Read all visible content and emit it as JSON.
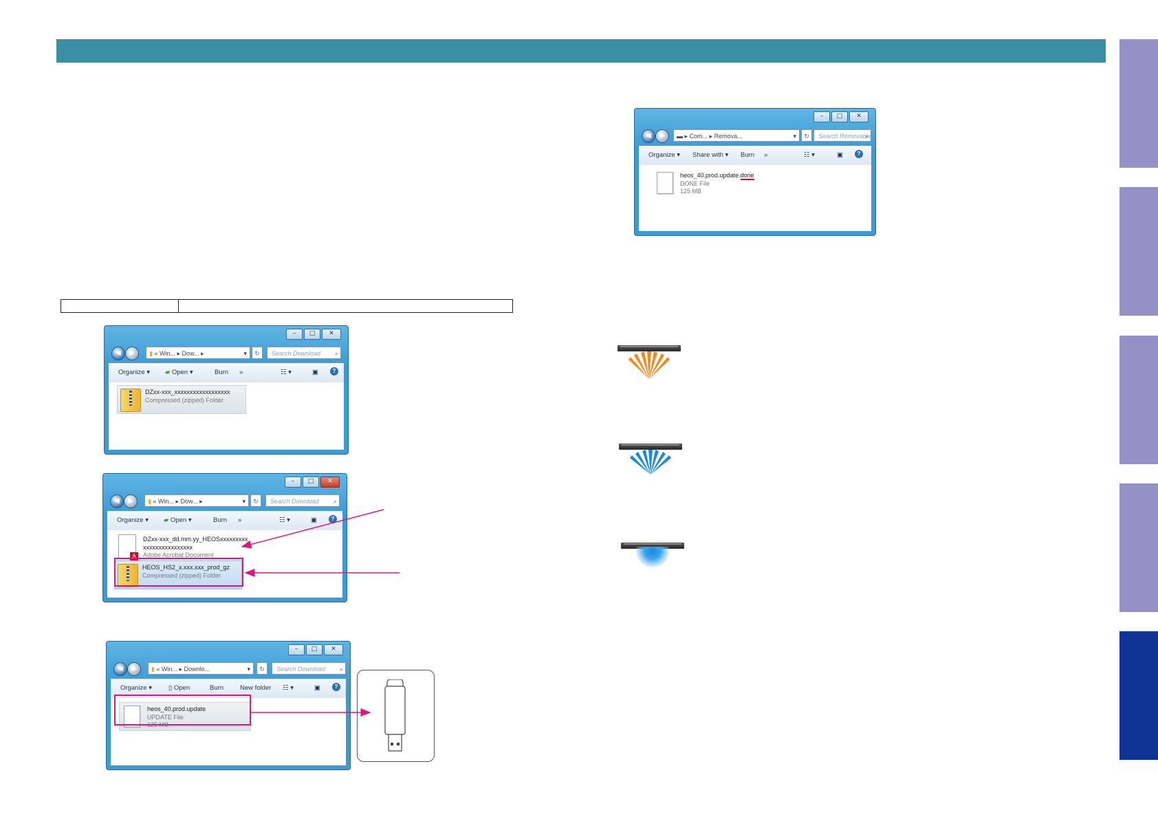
{
  "explorer_top_right": {
    "address_parts": [
      "Com...",
      "Remova..."
    ],
    "search_placeholder": "Search Removable ...",
    "toolbar": {
      "organize": "Organize",
      "share_with": "Share with",
      "burn": "Burn",
      "more": "»"
    },
    "file": {
      "name_prefix": "heos_40.prod.update.",
      "name_suffix": "done",
      "type": "DONE File",
      "size": "125 MB"
    }
  },
  "explorer_1": {
    "address_parts": [
      "«",
      "Win...",
      "Dow..."
    ],
    "search_placeholder": "Search Download",
    "toolbar": {
      "organize": "Organize",
      "open": "Open",
      "burn": "Burn",
      "more": "»"
    },
    "file": {
      "name": "DZxx-xxx_xxxxxxxxxxxxxxxxxx",
      "type": "Compressed (zipped) Folder"
    }
  },
  "explorer_2": {
    "address_parts": [
      "«",
      "Win...",
      "Dow..."
    ],
    "search_placeholder": "Search Download",
    "toolbar": {
      "organize": "Organize",
      "open": "Open",
      "burn": "Burn",
      "more": "»"
    },
    "file_pdf": {
      "name_line1": "DZxx-xxx_dd.mm.yy_HEOSxxxxxxxxx",
      "name_line2": "xxxxxxxxxxxxxxxx",
      "type": "Adobe Acrobat Document"
    },
    "file_zip": {
      "name": "HEOS_HS2_x.xxx.xxx_prod_gz",
      "type": "Compressed (zipped) Folder"
    }
  },
  "explorer_3": {
    "address_parts": [
      "«",
      "Win...",
      "Downlo..."
    ],
    "search_placeholder": "Search Download",
    "toolbar": {
      "organize": "Organize",
      "open": "Open",
      "burn": "Burn",
      "new_folder": "New folder"
    },
    "file": {
      "name": "heos_40.prod.update",
      "type": "UPDATE File",
      "size": "125 MB"
    }
  },
  "colors": {
    "header": "#3a8fa5",
    "side_tab": "#9590c5",
    "side_tab_active": "#0f3496",
    "callout": "#e0167f",
    "led_amber": "#f08a1a",
    "led_blue": "#1a8ad8"
  },
  "side_tabs": {
    "count": 5,
    "active_index": 4
  }
}
